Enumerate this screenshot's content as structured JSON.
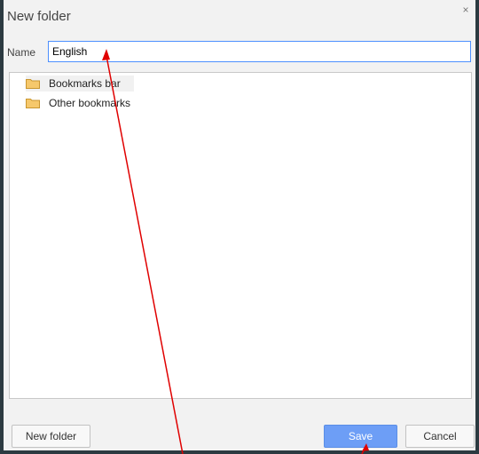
{
  "dialog": {
    "title": "New folder",
    "close_symbol": "×",
    "name_label": "Name",
    "name_value": "English"
  },
  "tree": {
    "items": [
      {
        "label": "Bookmarks bar",
        "icon": "folder-icon"
      },
      {
        "label": "Other bookmarks",
        "icon": "folder-icon"
      }
    ]
  },
  "buttons": {
    "new_folder": "New folder",
    "save": "Save",
    "cancel": "Cancel"
  },
  "colors": {
    "accent": "#4d90fe",
    "save_button": "#6d9ef6",
    "folder": "#f6c86b",
    "annotation": "#e00000"
  }
}
